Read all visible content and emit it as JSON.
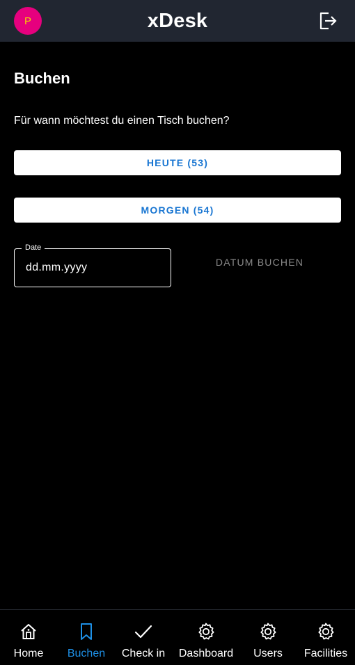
{
  "header": {
    "avatar_initial": "P",
    "title": "xDesk",
    "logout_icon": "logout-icon"
  },
  "main": {
    "page_title": "Buchen",
    "question": "Für wann möchtest du einen Tisch buchen?",
    "today_button": "HEUTE (53)",
    "tomorrow_button": "MORGEN (54)",
    "date_field": {
      "label": "Date",
      "placeholder": "dd.mm.yyyy",
      "value": ""
    },
    "book_date_button": "DATUM BUCHEN"
  },
  "nav": {
    "items": [
      {
        "label": "Home",
        "icon": "home-icon"
      },
      {
        "label": "Buchen",
        "icon": "bookmark-icon",
        "active": true
      },
      {
        "label": "Check in",
        "icon": "check-icon"
      },
      {
        "label": "Dashboard",
        "icon": "gear-icon"
      },
      {
        "label": "Users",
        "icon": "gear-icon"
      },
      {
        "label": "Facilities",
        "icon": "gear-icon"
      }
    ]
  },
  "colors": {
    "header_bg": "#212631",
    "avatar_bg": "#e6007e",
    "avatar_text": "#f5d400",
    "accent": "#1976d2",
    "active_nav": "#1e90e6",
    "disabled_text": "#8a8a8a"
  }
}
